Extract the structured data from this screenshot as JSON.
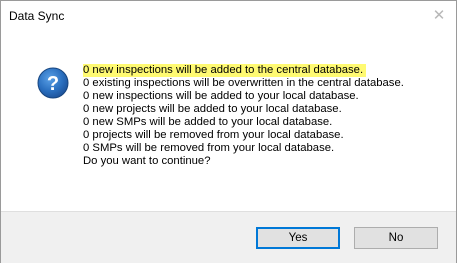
{
  "window": {
    "title": "Data Sync",
    "close_glyph": "✕"
  },
  "icon": {
    "name": "question-icon",
    "glyph": "?",
    "color": "#1f5ea8"
  },
  "messages": [
    "0 new inspections will be added to the central database.",
    "0 existing inspections will be overwritten in the central database.",
    "0 new inspections will be added to your local database.",
    "0 new projects will be added to your local database.",
    "0 new SMPs will be added to your local database.",
    "0 projects will be removed from your local database.",
    "0 SMPs will be removed from your local database.",
    "Do you want to continue?"
  ],
  "highlight_color": "#fffa72",
  "buttons": {
    "yes": "Yes",
    "no": "No"
  }
}
